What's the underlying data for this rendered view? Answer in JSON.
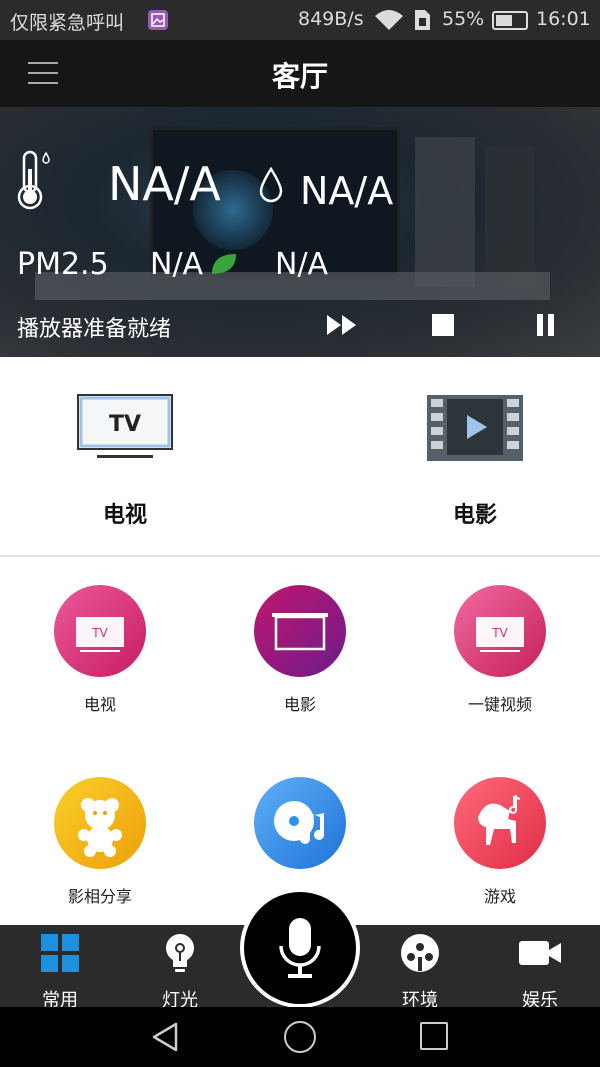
{
  "statusbar": {
    "carrier": "仅限紧急呼叫",
    "speed": "849B/s",
    "battery": "55%",
    "time": "16:01"
  },
  "header": {
    "title": "客厅",
    "menu_icon": "hamburger-menu-icon"
  },
  "environment": {
    "temperature": "NA/A",
    "humidity": "NA/A",
    "pm_label": "PM2.5",
    "pm_value": "N/A",
    "extra_value": "N/A",
    "icons": [
      "thermometer-icon",
      "water-drop-icon",
      "leaf-icon"
    ]
  },
  "player": {
    "status": "播放器准备就绪",
    "controls": [
      "fast-forward-icon",
      "stop-icon",
      "pause-icon"
    ]
  },
  "main_items": [
    {
      "label": "电视",
      "icon": "tv-icon",
      "icon_text": "TV"
    },
    {
      "label": "电影",
      "icon": "film-play-icon"
    }
  ],
  "grid": [
    {
      "label": "电视",
      "icon": "tv-icon",
      "icon_text": "TV",
      "color": "#e0357a"
    },
    {
      "label": "电影",
      "icon": "projector-screen-icon",
      "color": "#a0166e"
    },
    {
      "label": "一键视频",
      "icon": "tv-icon",
      "icon_text": "TV",
      "color": "#e03a6a"
    },
    {
      "label": "影相分享",
      "icon": "teddy-bear-icon",
      "color": "#f3b410"
    },
    {
      "label": "",
      "icon": "music-disc-icon",
      "color": "#2f8ff0"
    },
    {
      "label": "游戏",
      "icon": "rocking-horse-icon",
      "color": "#f0485c"
    }
  ],
  "tabs": [
    {
      "label": "常用",
      "icon": "grid-icon",
      "active": true
    },
    {
      "label": "灯光",
      "icon": "bulb-icon"
    },
    {
      "label": "",
      "icon": "microphone-icon"
    },
    {
      "label": "环境",
      "icon": "environment-icon"
    },
    {
      "label": "娱乐",
      "icon": "video-camera-icon"
    }
  ],
  "colors": {
    "accent": "#1e90e0",
    "tabbar": "#2b2b2b"
  }
}
